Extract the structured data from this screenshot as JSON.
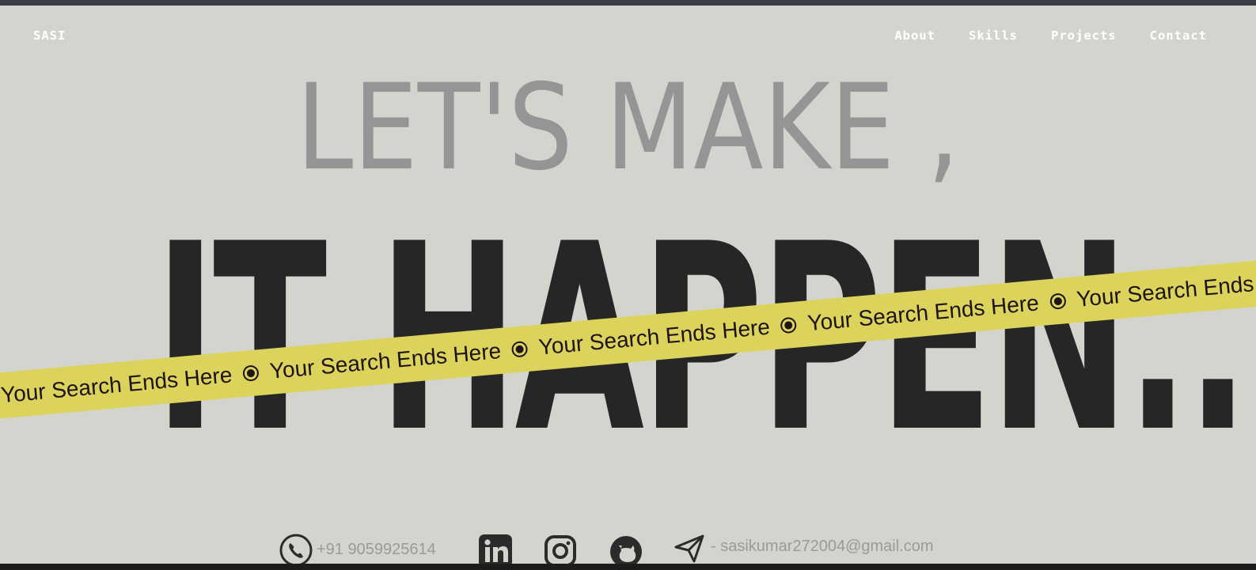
{
  "nav": {
    "brand": "SASI",
    "links": [
      "About",
      "Skills",
      "Projects",
      "Contact"
    ]
  },
  "hero": {
    "line1": "LET'S MAKE ,",
    "line2": "IT HAPPEN.."
  },
  "ribbon": {
    "text": "Your Search Ends Here",
    "separator_icon": "target-dot-icon"
  },
  "contact": {
    "phone": "+91 9059925614",
    "email": "- sasikumar272004@gmail.com",
    "icons": [
      "phone-icon",
      "linkedin-icon",
      "instagram-icon",
      "github-icon",
      "send-icon"
    ]
  },
  "colors": {
    "background": "#d4d4cf",
    "headline_light": "#959595",
    "headline_dark": "#262626",
    "ribbon": "#dcd35c",
    "nav_text": "#ffffff",
    "contact_text": "#9a9a9a"
  }
}
